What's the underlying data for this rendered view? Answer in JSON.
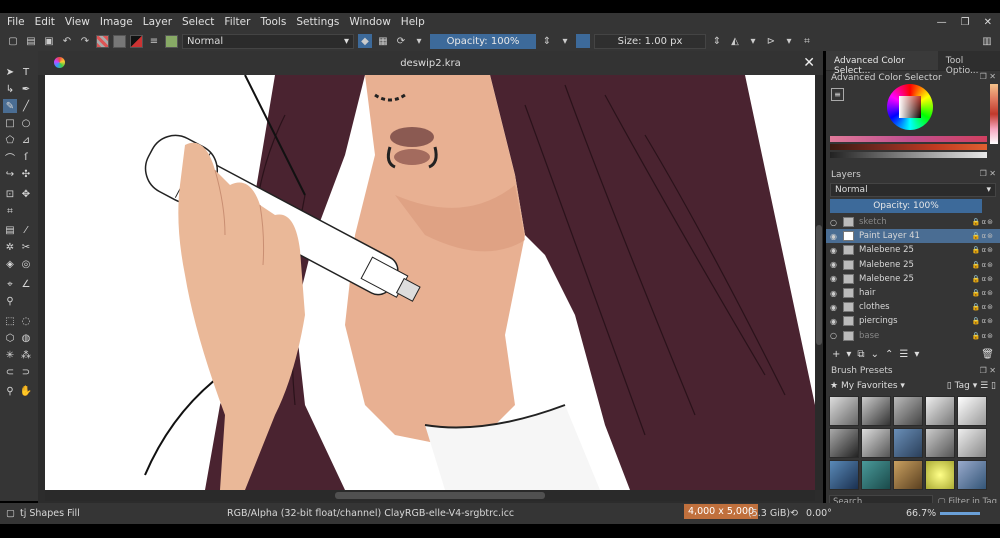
{
  "menu": [
    "File",
    "Edit",
    "View",
    "Image",
    "Layer",
    "Select",
    "Filter",
    "Tools",
    "Settings",
    "Window",
    "Help"
  ],
  "toolbar": {
    "blend_mode": "Normal",
    "opacity": "Opacity: 100%",
    "size": "Size: 1.00 px"
  },
  "document": {
    "title": "deswip2.kra"
  },
  "dock": {
    "tabs": [
      "Advanced Color Select...",
      "Tool Optio..."
    ],
    "color_panel_title": "Advanced Color Selector",
    "layers_title": "Layers",
    "layers_blend": "Normal",
    "layers_opacity": "Opacity: 100%",
    "layers": [
      {
        "name": "sketch",
        "visible": false,
        "selected": false
      },
      {
        "name": "Paint Layer 41",
        "visible": true,
        "selected": true
      },
      {
        "name": "Malebene 25",
        "visible": true,
        "selected": false
      },
      {
        "name": "Malebene 25",
        "visible": true,
        "selected": false
      },
      {
        "name": "Malebene 25",
        "visible": true,
        "selected": false
      },
      {
        "name": "hair",
        "visible": true,
        "selected": false
      },
      {
        "name": "clothes",
        "visible": true,
        "selected": false
      },
      {
        "name": "piercings",
        "visible": true,
        "selected": false
      },
      {
        "name": "base",
        "visible": false,
        "selected": false
      }
    ],
    "brush_title": "Brush Presets",
    "brush_group": "My Favorites",
    "brush_tag": "Tag",
    "brush_search_placeholder": "Search",
    "filter_in_tag": "Filter in Tag"
  },
  "status": {
    "tool": "tj Shapes Fill",
    "color_space": "RGB/Alpha (32-bit float/channel)  ClayRGB-elle-V4-srgbtrc.icc",
    "dimensions": "4,000 x 5,000",
    "memory": "(5.3 GiB)",
    "rotation": "0.00°",
    "zoom": "66.7%"
  },
  "colors": {
    "hair": "#4a2330",
    "skin": "#e8b092",
    "accent": "#3d6a9a",
    "selected_layer": "#4a6d93",
    "dimensions_badge": "#c0703d"
  }
}
